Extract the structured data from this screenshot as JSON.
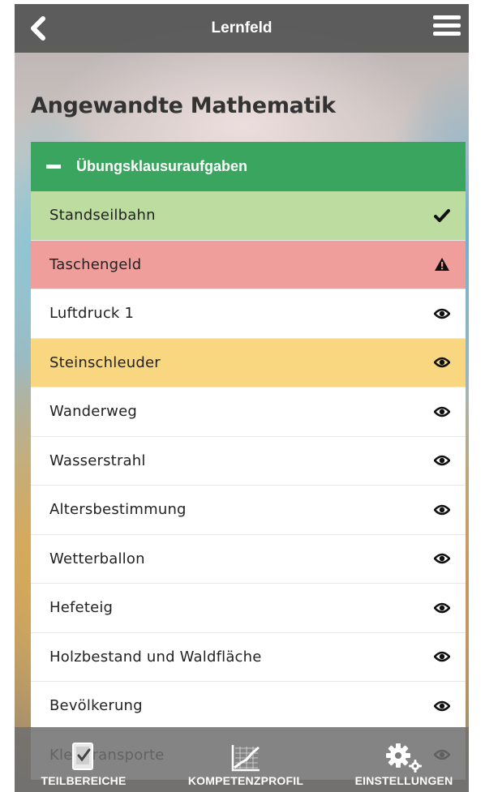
{
  "header": {
    "title": "Lernfeld",
    "back_icon": "chevron-left-icon",
    "menu_icon": "hamburger-menu-icon"
  },
  "page": {
    "title": "Angewandte Mathematik"
  },
  "section": {
    "label": "Übungsklausuraufgaben",
    "toggle_icon": "minus-icon",
    "color": "#3aa55e"
  },
  "items": [
    {
      "label": "Standseilbahn",
      "status": "done",
      "icon": "checkmark-icon",
      "color": "#bcdca0"
    },
    {
      "label": "Taschengeld",
      "status": "warning",
      "icon": "warning-icon",
      "color": "#ef9e9c"
    },
    {
      "label": "Luftdruck 1",
      "status": "view",
      "icon": "eye-icon",
      "color": "#ffffff"
    },
    {
      "label": "Steinschleuder",
      "status": "view",
      "icon": "eye-icon",
      "color": "#f9d780"
    },
    {
      "label": "Wanderweg",
      "status": "view",
      "icon": "eye-icon",
      "color": "#ffffff"
    },
    {
      "label": "Wasserstrahl",
      "status": "view",
      "icon": "eye-icon",
      "color": "#ffffff"
    },
    {
      "label": "Altersbestimmung",
      "status": "view",
      "icon": "eye-icon",
      "color": "#ffffff"
    },
    {
      "label": "Wetterballon",
      "status": "view",
      "icon": "eye-icon",
      "color": "#ffffff"
    },
    {
      "label": "Hefeteig",
      "status": "view",
      "icon": "eye-icon",
      "color": "#ffffff"
    },
    {
      "label": "Holzbestand und Waldfläche",
      "status": "view",
      "icon": "eye-icon",
      "color": "#ffffff"
    },
    {
      "label": "Bevölkerung",
      "status": "view",
      "icon": "eye-icon",
      "color": "#ffffff"
    },
    {
      "label": "Kleintransporte",
      "status": "view",
      "icon": "eye-icon",
      "color": "#ffffff"
    }
  ],
  "tabbar": {
    "tabs": [
      {
        "label": "TEILBEREICHE",
        "icon": "checklist-icon"
      },
      {
        "label": "KOMPETENZPROFIL",
        "icon": "line-chart-icon"
      },
      {
        "label": "EINSTELLUNGEN",
        "icon": "gears-icon"
      }
    ]
  }
}
